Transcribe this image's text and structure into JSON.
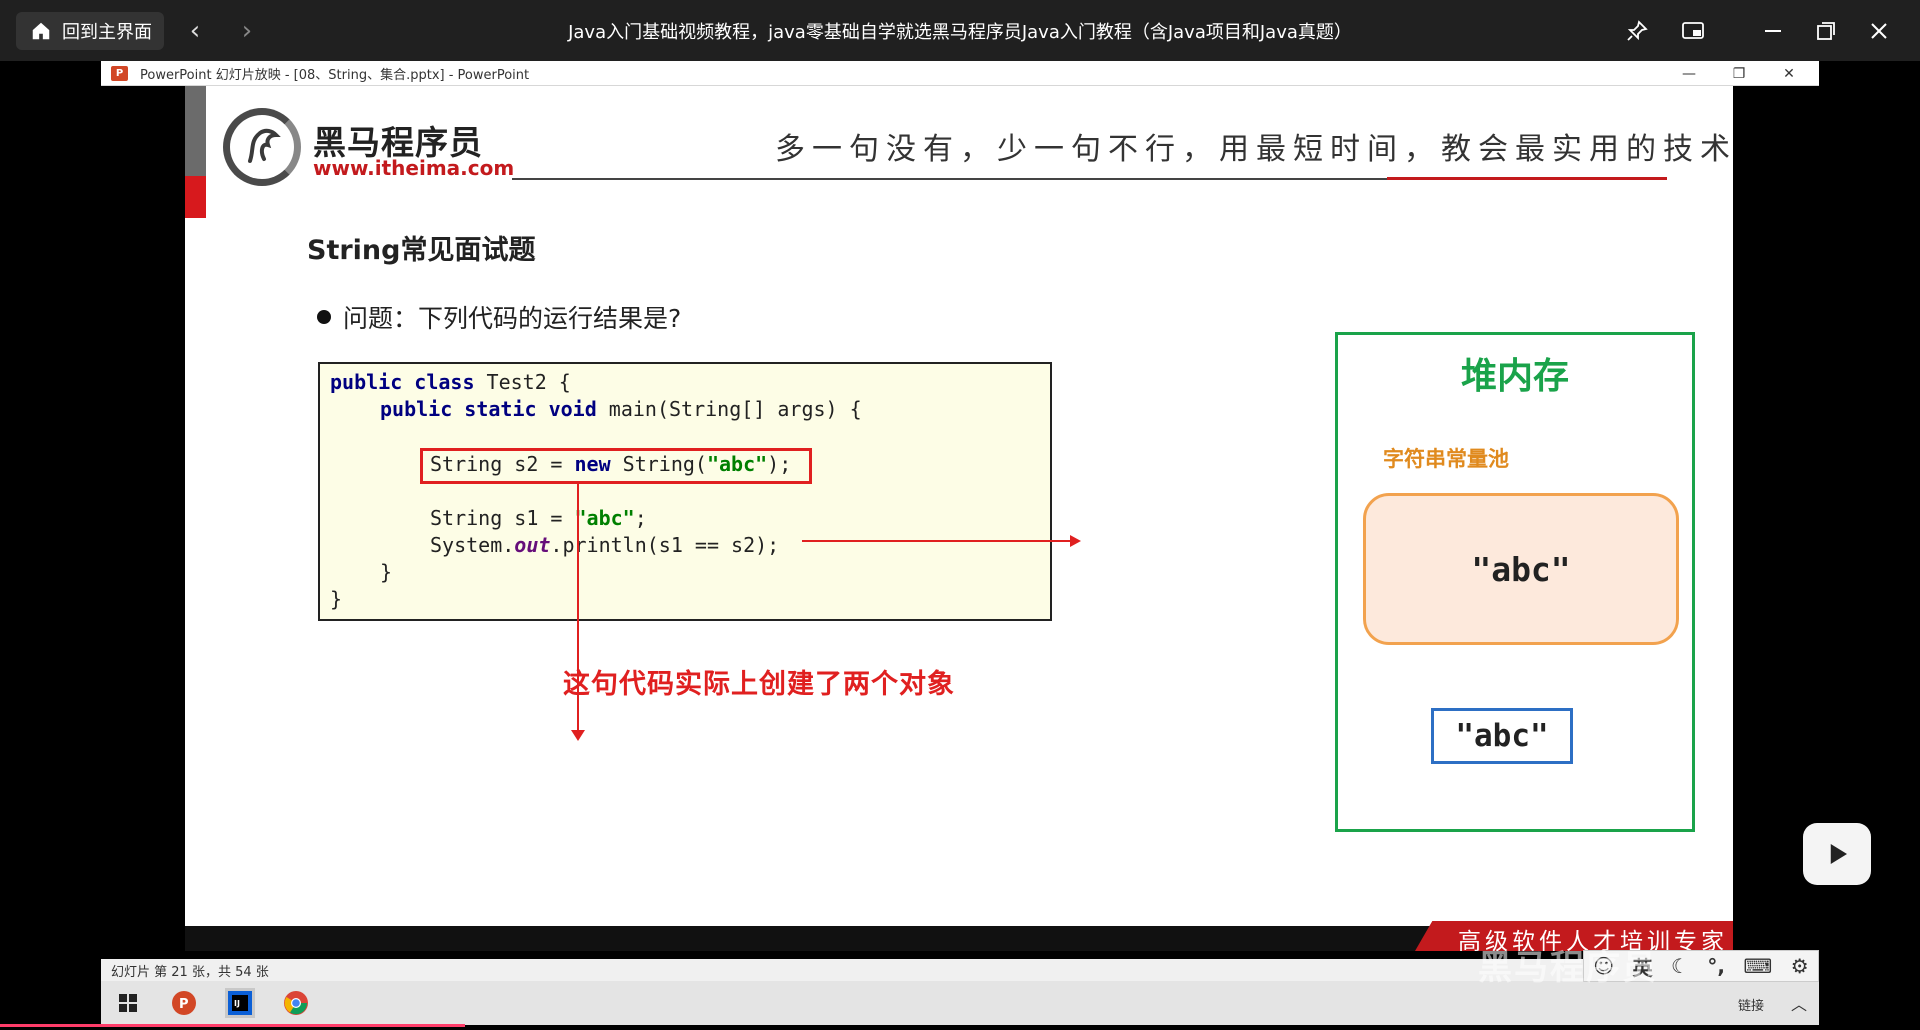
{
  "player": {
    "home_label": "回到主界面",
    "title": "Java入门基础视频教程，java零基础自学就选黑马程序员Java入门教程（含Java项目和Java真题）"
  },
  "ppt": {
    "window_title": "PowerPoint 幻灯片放映 - [08、String、集合.pptx] - PowerPoint",
    "icon_letter": "P",
    "status": "幻灯片 第 21 张，共 54 张"
  },
  "slide": {
    "logo_cn": "黑马程序员",
    "logo_url": "www.itheima.com",
    "slogan": "多一句没有，少一句不行，用最短时间，教会最实用的技术！",
    "heading": "String常见面试题",
    "question": "问题：下列代码的运行结果是?",
    "code": {
      "l1_kw": "public class",
      "l1_rest": " Test2 {",
      "l2_kw": "public static void",
      "l2_rest": " main(String[] args) {",
      "l3_a": "String s2 = ",
      "l3_kw": "new",
      "l3_b": " String(",
      "l3_str": "\"abc\"",
      "l3_c": ");",
      "l4_a": "String s1 = ",
      "l4_str": "\"abc\"",
      "l4_c": ";",
      "l5_a": "System.",
      "l5_fld": "out",
      "l5_b": ".println(s1 == s2);",
      "l6": "}",
      "l7": "}"
    },
    "annotation": "这句代码实际上创建了两个对象",
    "heap": {
      "title": "堆内存",
      "pool_label": "字符串常量池",
      "pool_value": "\"abc\"",
      "object_value": "\"abc\""
    },
    "footer": "高级软件人才培训专家"
  },
  "taskbar": {
    "tray_link": "链接",
    "ime_lang": "英"
  },
  "watermark": "黑马程序员"
}
